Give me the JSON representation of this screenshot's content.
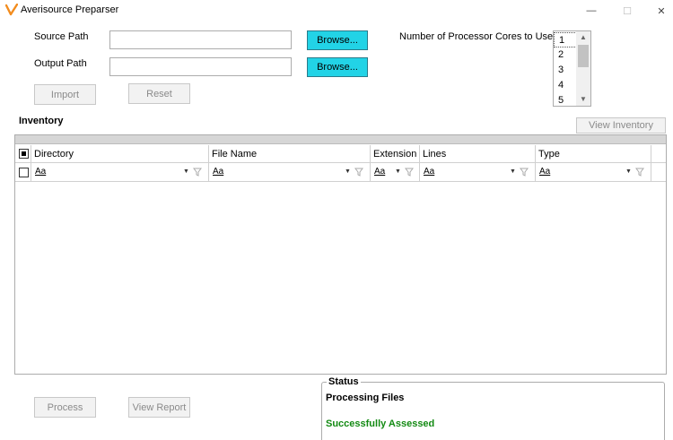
{
  "window": {
    "title": "Averisource Preparser",
    "logo_color": "#f28c1e",
    "controls": {
      "minimize": "—",
      "maximize": "☐",
      "close": "✕"
    }
  },
  "paths": {
    "source_label": "Source Path",
    "source_value": "",
    "output_label": "Output Path",
    "output_value": "",
    "browse_label": "Browse...",
    "browse_color": "#22d3e6"
  },
  "actions": {
    "import_label": "Import",
    "reset_label": "Reset",
    "process_label": "Process",
    "view_report_label": "View Report",
    "view_inventory_label": "View Inventory"
  },
  "cores": {
    "label": "Number of Processor Cores to Use",
    "options": [
      "1",
      "2",
      "3",
      "4",
      "5"
    ],
    "selected": "1"
  },
  "inventory": {
    "title": "Inventory",
    "columns": [
      "Directory",
      "File Name",
      "Extension",
      "Lines",
      "Type"
    ],
    "filter_text": "Aa",
    "rows": []
  },
  "status": {
    "title": "Status",
    "processing": "Processing Files",
    "result": "Successfully Assessed",
    "result_color": "#138a13"
  }
}
